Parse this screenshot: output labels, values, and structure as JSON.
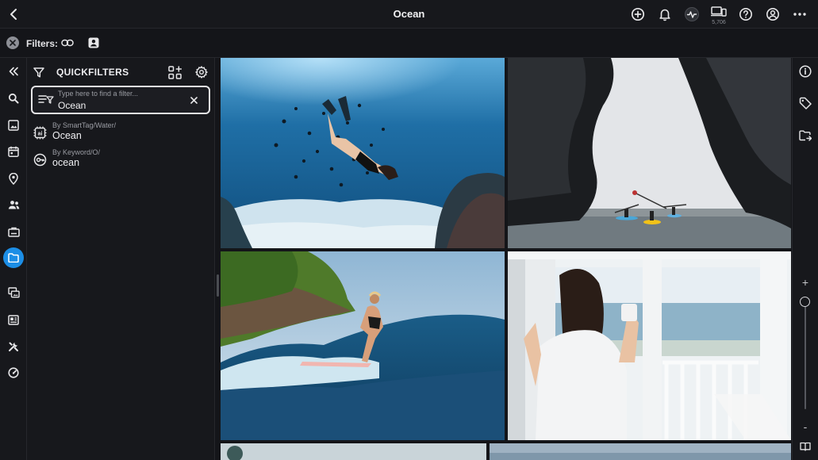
{
  "header": {
    "title": "Ocean",
    "device_count": "5,706",
    "icons": [
      "add-circle-icon",
      "bell-icon",
      "activity-icon",
      "devices-icon",
      "help-icon",
      "account-icon",
      "more-icon"
    ]
  },
  "filters": {
    "label": "Filters:",
    "icons": [
      "link-icon",
      "face-icon"
    ]
  },
  "left_rail": {
    "items": [
      "collapse-icon",
      "search-icon",
      "image-icon",
      "calendar-icon",
      "location-icon",
      "people-icon",
      "briefcase-icon",
      "folder-icon",
      "copies-icon",
      "layout-icon",
      "tools-icon",
      "gauge-icon"
    ],
    "active": "folder-icon"
  },
  "quickfilters": {
    "title": "QUICKFILTERS",
    "search": {
      "placeholder": "Type here to find a filter...",
      "value": "Ocean"
    },
    "results": [
      {
        "source": "By SmartTag/Water/",
        "label": "Ocean",
        "icon": "ai-chip-icon"
      },
      {
        "source": "By Keyword/O/",
        "label": "ocean",
        "icon": "keyword-icon"
      }
    ]
  },
  "gallery": {
    "photos": [
      {
        "name": "photo-underwater-swimmer",
        "description_icon": "image"
      },
      {
        "name": "photo-sea-cave-kayaks",
        "description_icon": "image"
      },
      {
        "name": "photo-surfer-wave",
        "description_icon": "image"
      },
      {
        "name": "photo-woman-window-ocean",
        "description_icon": "image"
      },
      {
        "name": "photo-partial-left",
        "description_icon": "image"
      },
      {
        "name": "photo-partial-right",
        "description_icon": "image"
      }
    ]
  },
  "right_rail": {
    "items": [
      "info-icon",
      "tag-icon",
      "folder-move-icon"
    ],
    "zoom": {
      "plus": "+",
      "minus": "-",
      "level": 0.1
    }
  },
  "colors": {
    "accent": "#1c8ee6",
    "background": "#141519",
    "panel": "#17181c"
  }
}
